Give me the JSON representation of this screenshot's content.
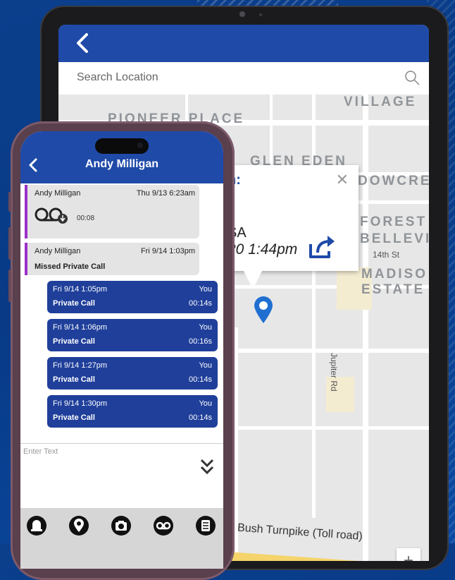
{
  "tablet": {
    "search_placeholder": "Search Location",
    "popup": {
      "title_fragment": "n:",
      "close_glyph": "✕",
      "line1": "SA",
      "line2": "20 1:44pm"
    },
    "map_labels": {
      "village": "VILLAGE",
      "pioneer_place": "PIONEER PLACE",
      "glen_eden": "GLEN EDEN",
      "dowcre": "DOWCRE",
      "forest": "FOREST",
      "bellevi": "BELLEVI",
      "madiso": "MADISO",
      "estate": "ESTATE",
      "street_14th": "14th St",
      "jupiter_rd": "Jupiter Rd",
      "toll_road": "ge Bush Turnpike (Toll road)"
    },
    "zoom_in_label": "+"
  },
  "phone": {
    "contact_name": "Andy Milligan",
    "messages_in": [
      {
        "name": "Andy Milligan",
        "timestamp": "Thu 9/13 6:23am",
        "voicemail_duration": "00:08"
      },
      {
        "name": "Andy Milligan",
        "timestamp": "Fri 9/14 1:03pm",
        "text": "Missed Private Call"
      }
    ],
    "messages_out": [
      {
        "timestamp": "Fri 9/14 1:05pm",
        "who": "You",
        "type": "Private Call",
        "duration": "00:14s"
      },
      {
        "timestamp": "Fri 9/14 1:06pm",
        "who": "You",
        "type": "Private Call",
        "duration": "00:16s"
      },
      {
        "timestamp": "Fri 9/14 1:27pm",
        "who": "You",
        "type": "Private Call",
        "duration": "00:14s"
      },
      {
        "timestamp": "Fri 9/14 1:30pm",
        "who": "You",
        "type": "Private Call",
        "duration": "00:14s"
      }
    ],
    "input_placeholder": "Enter Text",
    "toolbar_icons": [
      "alert-icon",
      "location-icon",
      "camera-icon",
      "voicemail-icon",
      "notes-icon"
    ]
  },
  "colors": {
    "brand_blue": "#1f4aa8",
    "outgoing_bubble": "#1f3f9a",
    "incoming_accent": "#9b30c8"
  }
}
